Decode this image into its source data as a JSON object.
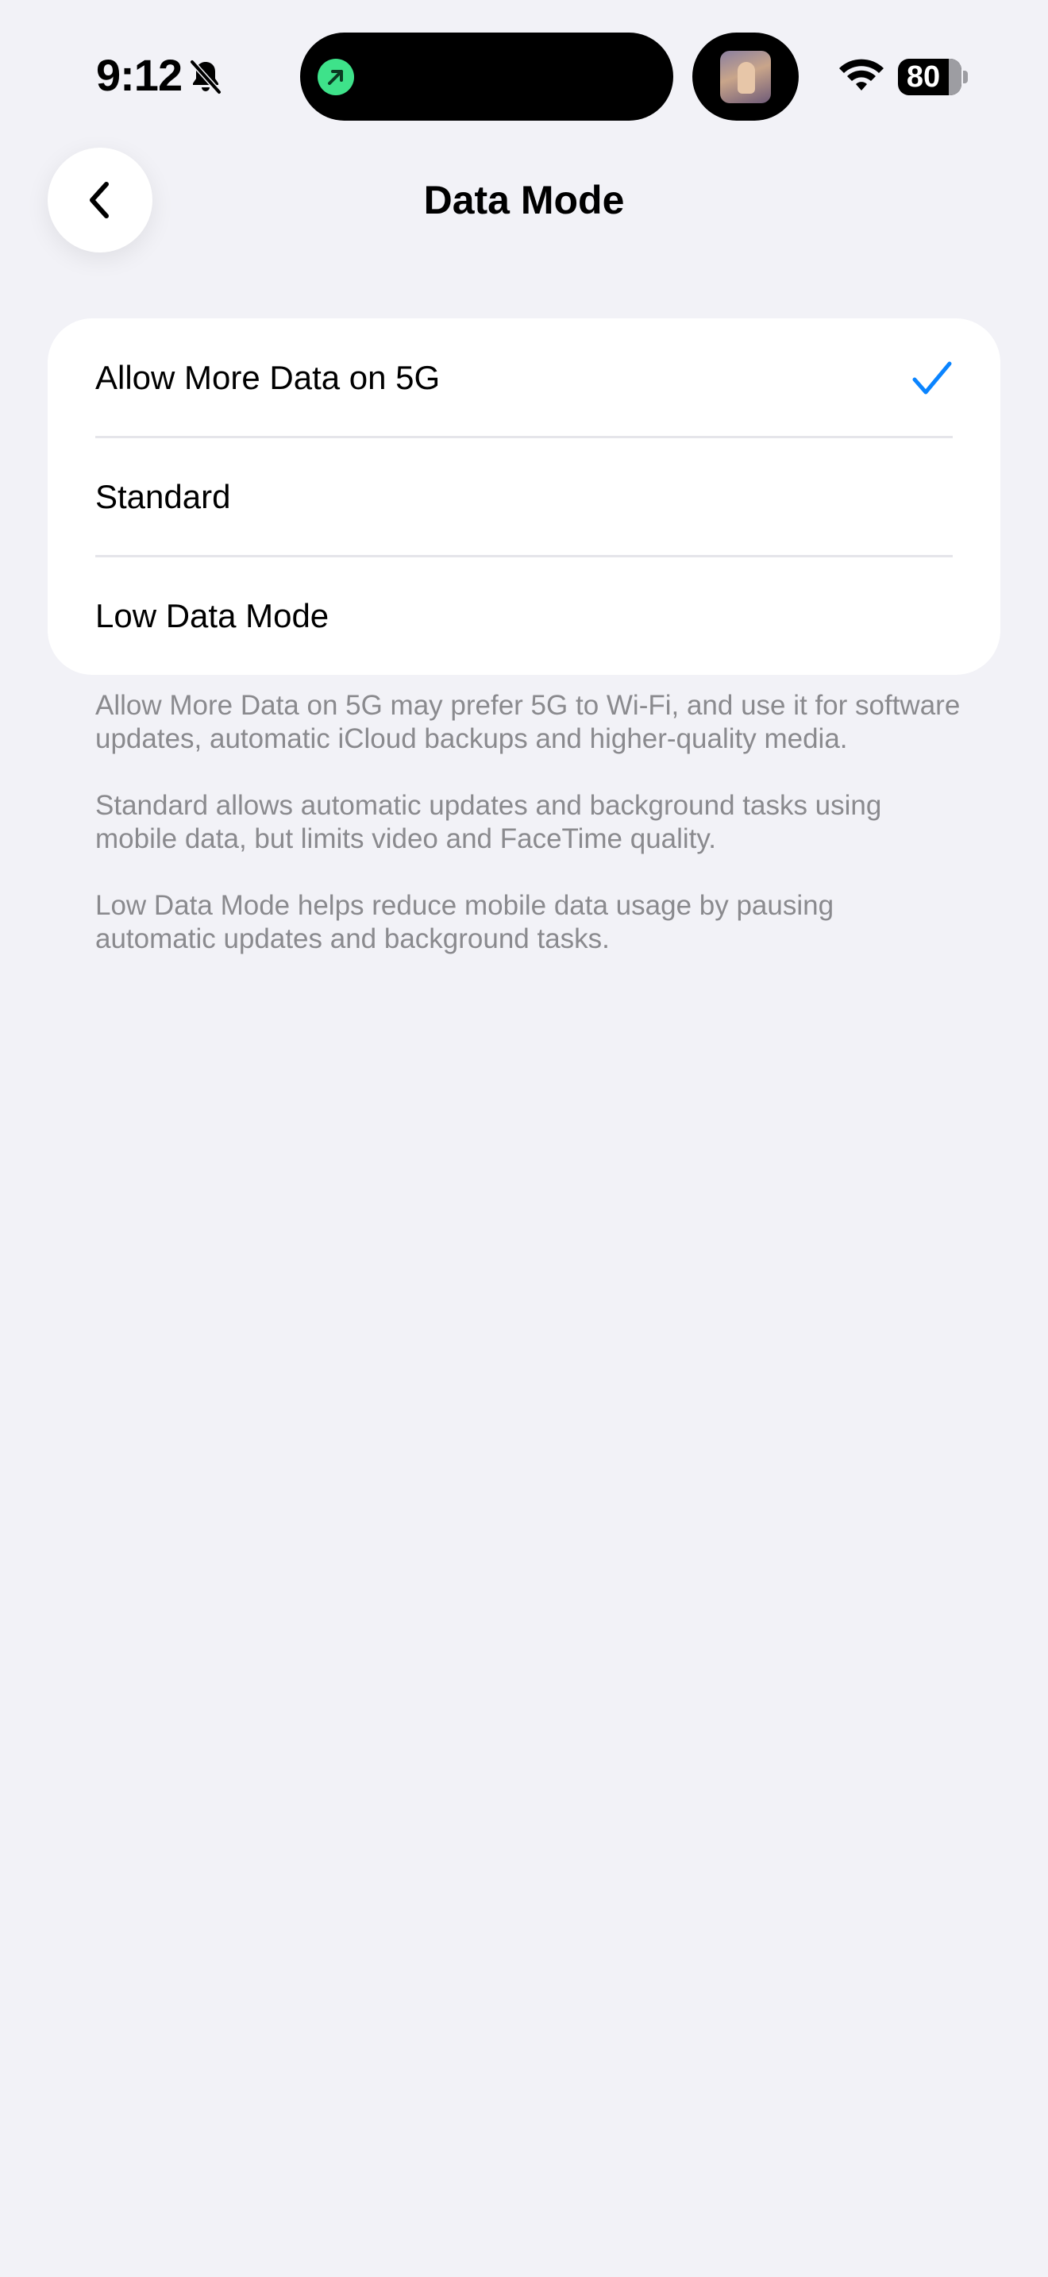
{
  "status_bar": {
    "time": "9:12",
    "battery": "80",
    "icons": [
      "bell-slash-icon",
      "wifi-icon",
      "battery-icon"
    ],
    "island_activity_color": "#3ee28a"
  },
  "nav": {
    "title": "Data Mode",
    "back_icon": "chevron-left-icon"
  },
  "options": [
    {
      "label": "Allow More Data on 5G",
      "selected": true
    },
    {
      "label": "Standard",
      "selected": false
    },
    {
      "label": "Low Data Mode",
      "selected": false
    }
  ],
  "accent_color": "#0a84ff",
  "notes": [
    "Allow More Data on 5G may prefer 5G to Wi-Fi, and use it for software updates, automatic iCloud backups and higher-quality media.",
    "Standard allows automatic updates and background tasks using mobile data, but limits video and FaceTime quality.",
    "Low Data Mode helps reduce mobile data usage by pausing automatic updates and background tasks."
  ]
}
